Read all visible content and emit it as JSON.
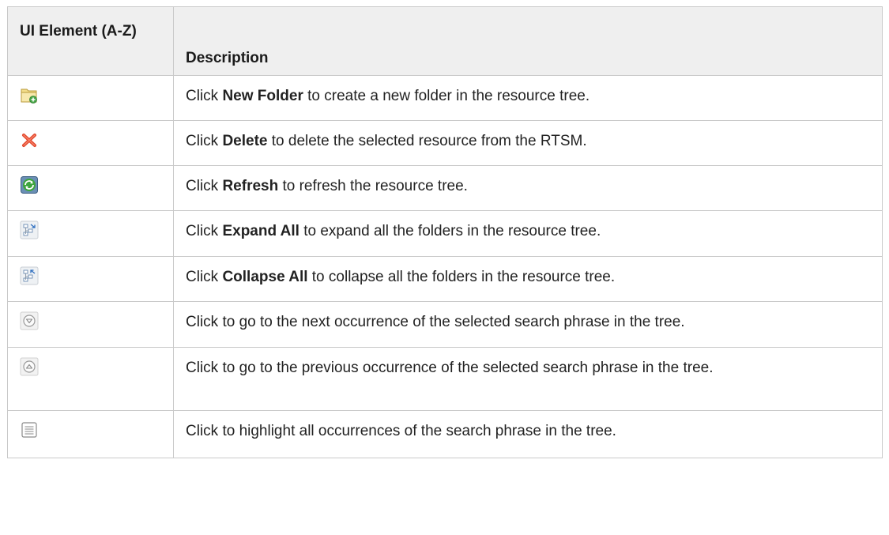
{
  "table": {
    "headers": {
      "element": "UI Element (A-Z)",
      "description": "Description"
    },
    "rows": [
      {
        "icon": "new-folder-icon",
        "pre": "Click ",
        "bold": "New Folder",
        "post": " to create a new folder in the resource tree."
      },
      {
        "icon": "delete-icon",
        "pre": "Click ",
        "bold": "Delete",
        "post": " to delete the selected resource from the RTSM."
      },
      {
        "icon": "refresh-icon",
        "pre": "Click ",
        "bold": "Refresh",
        "post": " to refresh the resource tree."
      },
      {
        "icon": "expand-all-icon",
        "pre": "Click ",
        "bold": "Expand All",
        "post": " to expand all the folders in the resource tree."
      },
      {
        "icon": "collapse-all-icon",
        "pre": "Click ",
        "bold": "Collapse All",
        "post": " to collapse all the folders in the resource tree."
      },
      {
        "icon": "next-occurrence-icon",
        "text": "Click to go to the next occurrence of the selected search phrase in the tree."
      },
      {
        "icon": "previous-occurrence-icon",
        "text": "Click to go to the previous occurrence of the selected search phrase in the tree."
      },
      {
        "icon": "highlight-all-icon",
        "text": "Click to highlight all occurrences of the search phrase in the tree."
      }
    ]
  }
}
